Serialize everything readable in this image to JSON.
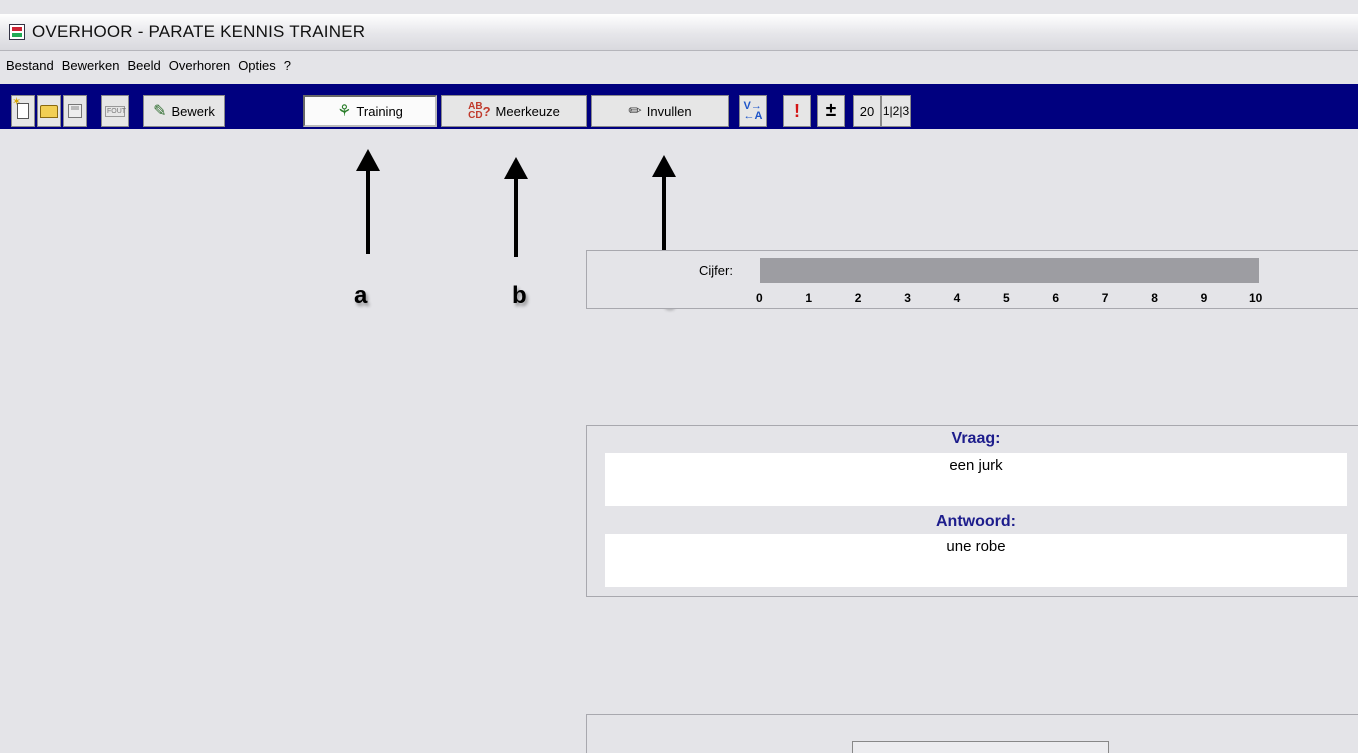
{
  "window": {
    "title": "OVERHOOR - PARATE KENNIS TRAINER"
  },
  "menu": [
    "Bestand",
    "Bewerken",
    "Beeld",
    "Overhoren",
    "Opties",
    "?"
  ],
  "toolbar": {
    "new_icon": "new-file-icon",
    "open_icon": "open-folder-icon",
    "save_icon": "save-disk-icon",
    "errors_icon_text": "FOUT",
    "edit_label": "Bewerk",
    "training_label": "Training",
    "multiple_choice_label": "Meerkeuze",
    "multiple_choice_icon_text": "AB\nCD?",
    "fill_in_label": "Invullen",
    "swap_icon_text": "V→\n←A",
    "alert_icon": "!",
    "plus_minus": "±",
    "count_label": "20",
    "steps_label": "1|2|3"
  },
  "annotations": {
    "a": "a",
    "b": "b",
    "c": "c"
  },
  "grade": {
    "label": "Cijfer:",
    "ticks": [
      "0",
      "1",
      "2",
      "3",
      "4",
      "5",
      "6",
      "7",
      "8",
      "9",
      "10"
    ],
    "value": 0
  },
  "question": {
    "heading": "Vraag:",
    "text": "een jurk"
  },
  "answer": {
    "heading": "Antwoord:",
    "text": "une robe"
  },
  "colors": {
    "toolbar_bg": "#00007f",
    "heading": "#1d1d8c",
    "grade_bar": "#9d9da2"
  }
}
